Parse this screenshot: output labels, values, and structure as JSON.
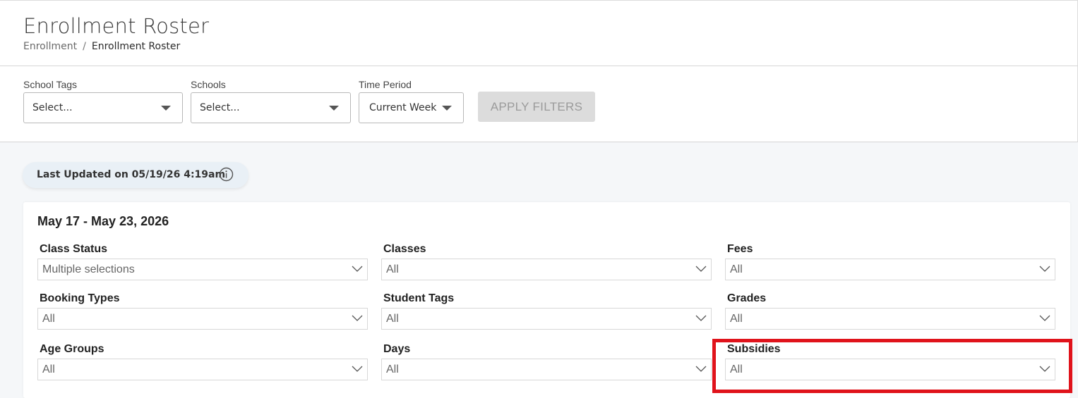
{
  "header": {
    "title": "Enrollment Roster",
    "breadcrumb": {
      "parent": "Enrollment",
      "separator": "/",
      "current": "Enrollment Roster"
    }
  },
  "filters": {
    "school_tags": {
      "label": "School Tags",
      "value": "Select..."
    },
    "schools": {
      "label": "Schools",
      "value": "Select..."
    },
    "time_period": {
      "label": "Time Period",
      "value": "Current Week"
    },
    "apply_label": "APPLY FILTERS"
  },
  "status": {
    "last_updated": "Last Updated on 05/19/26 4:19am",
    "icon": "info-circle-icon"
  },
  "roster": {
    "date_range": "May 17 - May 23, 2026",
    "fields": {
      "class_status": {
        "label": "Class Status",
        "value": "Multiple selections"
      },
      "classes": {
        "label": "Classes",
        "value": "All"
      },
      "fees": {
        "label": "Fees",
        "value": "All"
      },
      "booking_types": {
        "label": "Booking Types",
        "value": "All"
      },
      "student_tags": {
        "label": "Student Tags",
        "value": "All"
      },
      "grades": {
        "label": "Grades",
        "value": "All"
      },
      "age_groups": {
        "label": "Age Groups",
        "value": "All"
      },
      "days": {
        "label": "Days",
        "value": "All"
      },
      "subsidies": {
        "label": "Subsidies",
        "value": "All"
      }
    }
  },
  "colors": {
    "highlight": "#e0131b",
    "pill_bg": "#e9f0f6",
    "disabled_btn": "#dcdcdc"
  }
}
